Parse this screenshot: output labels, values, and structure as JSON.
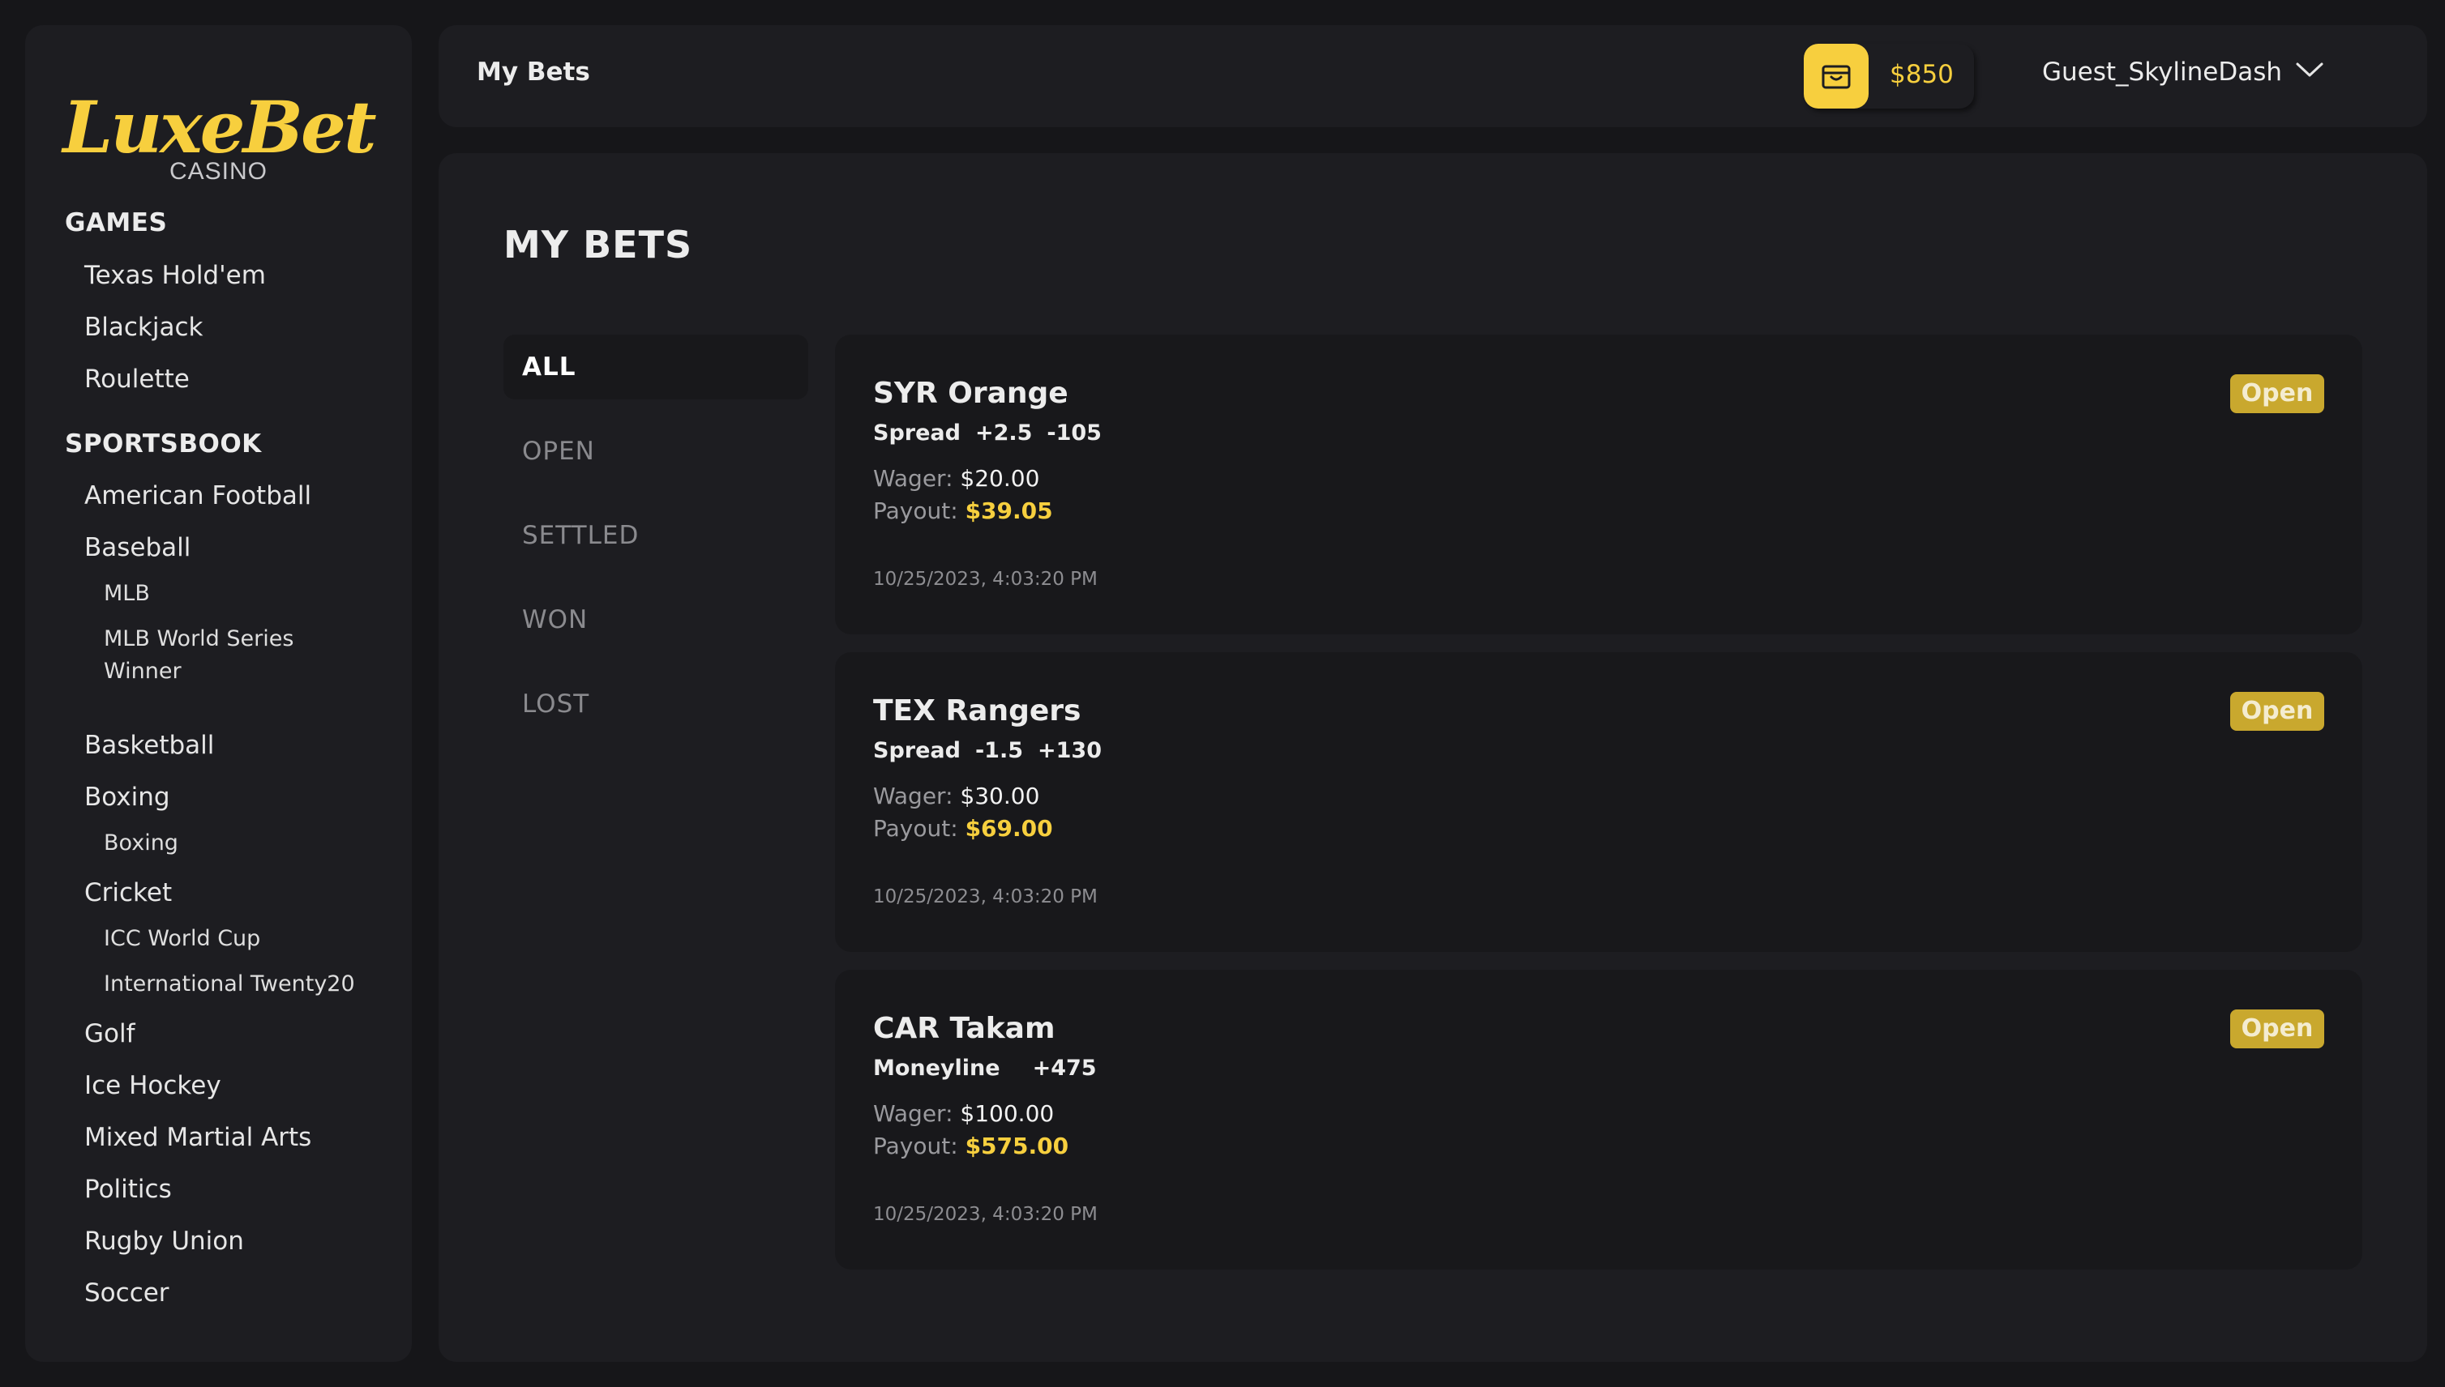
{
  "brand": {
    "name": "LuxeBet",
    "tagline": "CASINO"
  },
  "sidebar": {
    "games": {
      "title": "GAMES",
      "items": [
        "Texas Hold'em",
        "Blackjack",
        "Roulette"
      ]
    },
    "sportsbook": {
      "title": "SPORTSBOOK",
      "american_football": "American Football",
      "baseball": "Baseball",
      "mlb": "MLB",
      "mlb_ws_line1": "MLB World Series",
      "mlb_ws_line2": "Winner",
      "basketball": "Basketball",
      "boxing": "Boxing",
      "boxing_sub": "Boxing",
      "cricket": "Cricket",
      "icc": "ICC World Cup",
      "t20": "International Twenty20",
      "golf": "Golf",
      "ice_hockey": "Ice Hockey",
      "mma": "Mixed Martial Arts",
      "politics": "Politics",
      "rugby": "Rugby Union",
      "soccer": "Soccer"
    }
  },
  "header": {
    "title": "My Bets",
    "balance": "$850",
    "username": "Guest_SkylineDash"
  },
  "main": {
    "title": "MY BETS",
    "filters": [
      "ALL",
      "OPEN",
      "SETTLED",
      "WON",
      "LOST"
    ],
    "active_filter": "ALL",
    "wager_label": "Wager:",
    "payout_label": "Payout:",
    "bets": [
      {
        "team": "SYR Orange",
        "market": "Spread",
        "line": "+2.5",
        "odds": "-105",
        "wager": "$20.00",
        "payout": "$39.05",
        "date": "10/25/2023, 4:03:20 PM",
        "status": "Open"
      },
      {
        "team": "TEX Rangers",
        "market": "Spread",
        "line": "-1.5",
        "odds": "+130",
        "wager": "$30.00",
        "payout": "$69.00",
        "date": "10/25/2023, 4:03:20 PM",
        "status": "Open"
      },
      {
        "team": "CAR Takam",
        "market": "Moneyline",
        "line": "",
        "odds": "+475",
        "wager": "$100.00",
        "payout": "$575.00",
        "date": "10/25/2023, 4:03:20 PM",
        "status": "Open"
      }
    ]
  },
  "colors": {
    "accent": "#f7cf3e",
    "background": "#161619",
    "panel": "#1d1d21",
    "card": "#18181b",
    "badge": "#c9a82e"
  },
  "icons": {
    "wallet": "wallet-icon",
    "user_menu": "chevron-down-icon"
  }
}
